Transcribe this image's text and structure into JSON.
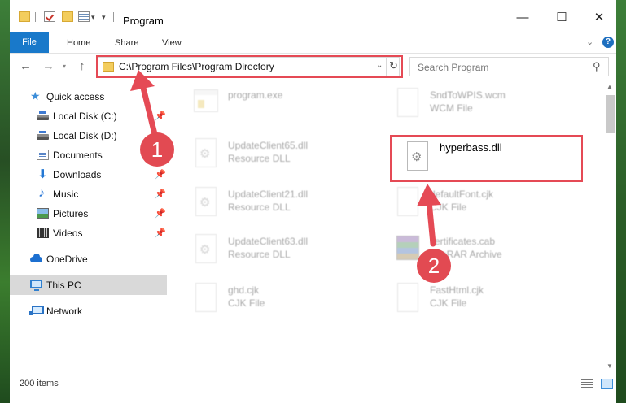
{
  "window": {
    "title": "Program",
    "controls": {
      "minimize": "—",
      "maximize": "☐",
      "close": "✕"
    }
  },
  "ribbon": {
    "tabs": [
      "File",
      "Home",
      "Share",
      "View"
    ],
    "help": "?"
  },
  "address": {
    "path": "C:\\Program Files\\Program Directory"
  },
  "search": {
    "placeholder": "Search Program"
  },
  "nav": {
    "items": [
      {
        "label": "Quick access",
        "icon": "star-icon",
        "pinned": false
      },
      {
        "label": "Local Disk (C:)",
        "icon": "disk-icon",
        "pinned": true
      },
      {
        "label": "Local Disk (D:)",
        "icon": "disk-icon",
        "pinned": false
      },
      {
        "label": "Documents",
        "icon": "documents-icon",
        "pinned": false
      },
      {
        "label": "Downloads",
        "icon": "download-icon",
        "pinned": true
      },
      {
        "label": "Music",
        "icon": "music-icon",
        "pinned": true
      },
      {
        "label": "Pictures",
        "icon": "pictures-icon",
        "pinned": true
      },
      {
        "label": "Videos",
        "icon": "videos-icon",
        "pinned": true
      },
      {
        "label": "OneDrive",
        "icon": "cloud-icon",
        "pinned": false
      },
      {
        "label": "This PC",
        "icon": "pc-icon",
        "pinned": false,
        "selected": true
      },
      {
        "label": "Network",
        "icon": "network-icon",
        "pinned": false
      }
    ]
  },
  "files": [
    {
      "name": "program.exe",
      "type": ""
    },
    {
      "name": "SndToWPIS.wcm",
      "type": "WCM File"
    },
    {
      "name": "UpdateClient65.dll",
      "type": "Resource DLL"
    },
    {
      "name": "hyperbass.dll",
      "type": ""
    },
    {
      "name": "UpdateClient21.dll",
      "type": "Resource DLL"
    },
    {
      "name": "defaultFont.cjk",
      "type": "CJK File"
    },
    {
      "name": "UpdateClient63.dll",
      "type": "Resource DLL"
    },
    {
      "name": "certificates.cab",
      "type": "WinRAR Archive"
    },
    {
      "name": "ghd.cjk",
      "type": "CJK File"
    },
    {
      "name": "FastHtml.cjk",
      "type": "CJK File"
    }
  ],
  "status": {
    "item_count": "200 items"
  },
  "annotations": {
    "badge1": "1",
    "badge2": "2"
  },
  "colors": {
    "accent": "#1979ca",
    "annotation": "#e54a55"
  }
}
